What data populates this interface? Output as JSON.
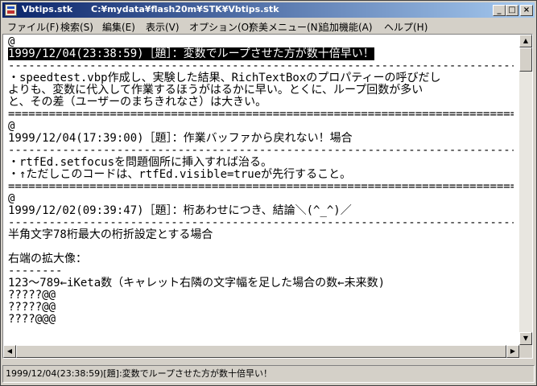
{
  "window": {
    "title": "Vbtips.stk",
    "path": "C:¥mydata¥flash20m¥STK¥Vbtips.stk",
    "minimize": "_",
    "maximize": "□",
    "close": "×"
  },
  "menu": [
    "ファイル(F)",
    "検索(S)",
    "編集(E)",
    "表示(V)",
    "オプション(O)",
    "奈美メニュー(N)",
    "追加機能(A)",
    "ヘルプ(H)"
  ],
  "editor": {
    "lines": [
      "@",
      "1999/12/04(23:38:59)［題］：変数でループさせた方が数十倍早い！",
      "------------------------------------------------------------------------------------",
      "・speedtest.vbp作成し、実験した結果、RichTextBoxのプロパティーの呼びだし",
      "よりも、変数に代入して作業するほうがはるかに早い。とくに、ループ回数が多い",
      "と、その差（ユーザーのまちきれなさ）は大きい。",
      "====================================================================================",
      "@",
      "1999/12/04(17:39:00)［題］：作業バッファから戻れない！場合",
      "------------------------------------------------------------------------------------",
      "・rtfEd.setfocusを問題個所に挿入すれば治る。",
      "・↑ただしこのコードは、rtfEd.visible=trueが先行すること。",
      "====================================================================================",
      "@",
      "1999/12/02(09:39:47)［題］：桁あわせにつき、結論＼(^_^)／",
      "------------------------------------------------------------------------------------",
      "半角文字78桁最大の桁折設定とする場合",
      "",
      "右端の拡大像：",
      "--------",
      "123〜789←iKeta数（キャレット右隣の文字幅を足した場合の数←未来数)",
      "?????@@",
      "?????@@",
      "????@@@"
    ]
  },
  "scroll": {
    "up": "▲",
    "down": "▼",
    "left": "◀",
    "right": "▶"
  },
  "status": {
    "text": "1999/12/04(23:38:59)[題]:変数でループさせた方が数十倍早い！"
  }
}
